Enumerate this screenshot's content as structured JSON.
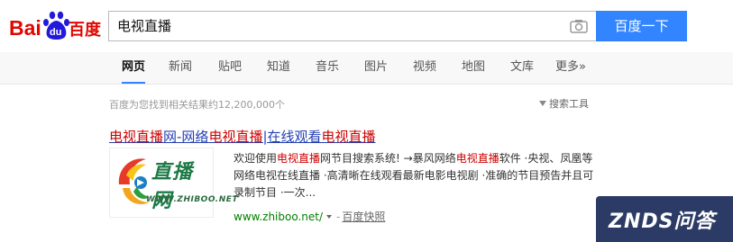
{
  "logo": {
    "part1": "Bai",
    "part2": "du",
    "part3": "百度"
  },
  "search": {
    "query": "电视直播",
    "button_label": "百度一下"
  },
  "nav": {
    "tabs": [
      {
        "label": "网页",
        "active": true
      },
      {
        "label": "新闻"
      },
      {
        "label": "贴吧"
      },
      {
        "label": "知道"
      },
      {
        "label": "音乐"
      },
      {
        "label": "图片"
      },
      {
        "label": "视频"
      },
      {
        "label": "地图"
      },
      {
        "label": "文库"
      },
      {
        "label": "更多»"
      }
    ]
  },
  "results_info": {
    "stats": "百度为您找到相关结果约12,200,000个",
    "tools_label": "搜索工具"
  },
  "result": {
    "title_parts": [
      {
        "text": "电视直播",
        "highlight": true
      },
      {
        "text": "网-网络",
        "highlight": false
      },
      {
        "text": "电视直播",
        "highlight": true
      },
      {
        "text": "|在线观看",
        "highlight": false
      },
      {
        "text": "电视直播",
        "highlight": true
      }
    ],
    "thumbnail": {
      "cn": "直播网",
      "en": "WWW.ZHIBOO.NET"
    },
    "snippet_parts": [
      {
        "text": "欢迎使用",
        "highlight": false
      },
      {
        "text": "电视直播",
        "highlight": true
      },
      {
        "text": "网节目搜索系统! →暴风网络",
        "highlight": false
      },
      {
        "text": "电视直播",
        "highlight": true
      },
      {
        "text": "软件 ·央视、凤凰等网络电视在线直播 ·高清晰在线观看最新电影电视剧 ·准确的节目预告并且可录制节目 ·一次...",
        "highlight": false
      }
    ],
    "url": "www.zhiboo.net/",
    "cache_label": "百度快照"
  },
  "watermark": {
    "text": "ZNDS问答"
  },
  "colors": {
    "link": "#2440b3",
    "highlight": "#c00000",
    "url": "#008000",
    "button": "#3385ff"
  }
}
